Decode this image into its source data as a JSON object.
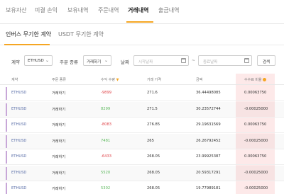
{
  "top_tabs": [
    {
      "label": "보유자산",
      "active": false
    },
    {
      "label": "미결 손익",
      "active": false
    },
    {
      "label": "보유내역",
      "active": false
    },
    {
      "label": "주문내역",
      "active": false
    },
    {
      "label": "거래내역",
      "active": true
    },
    {
      "label": "출금내역",
      "active": false
    }
  ],
  "sub_tabs": [
    {
      "label": "인버스 무기한 계약",
      "active": true
    },
    {
      "label": "USDT 무기한 계약",
      "active": false
    }
  ],
  "filters": {
    "contract_label": "계약",
    "contract_value": "ETHUSD",
    "order_type_label": "주문 종류",
    "order_type_value": "거래하기",
    "date_label": "날짜",
    "start_date_placeholder": "시작날짜",
    "end_date_placeholder": "종료날짜",
    "separator": "~",
    "search_label": "검색"
  },
  "table": {
    "headers": [
      "계약",
      "주문 종류",
      "수익 수량",
      "거래 가격",
      "금액",
      "수수료 비율"
    ],
    "rows": [
      {
        "symbol": "ETHUSD",
        "order_type": "거래하기",
        "qty": "-9899",
        "qty_sign": "neg",
        "price": "271.6",
        "amount": "36.44498085",
        "fee_rate": "0.00063750"
      },
      {
        "symbol": "ETHUSD",
        "order_type": "거래하기",
        "qty": "8299",
        "qty_sign": "pos",
        "price": "271.5",
        "amount": "30.23572744",
        "fee_rate": "-0.00025000"
      },
      {
        "symbol": "ETHUSD",
        "order_type": "거래하기",
        "qty": "-8083",
        "qty_sign": "neg",
        "price": "276.85",
        "amount": "29.19631569",
        "fee_rate": "0.00063750"
      },
      {
        "symbol": "ETHUSD",
        "order_type": "거래하기",
        "qty": "7481",
        "qty_sign": "pos",
        "price": "265",
        "amount": "26.26792452",
        "fee_rate": "-0.00025000"
      },
      {
        "symbol": "ETHUSD",
        "order_type": "거래하기",
        "qty": "-6433",
        "qty_sign": "neg",
        "price": "268.05",
        "amount": "23.99925387",
        "fee_rate": "0.00063750"
      },
      {
        "symbol": "ETHUSD",
        "order_type": "거래하기",
        "qty": "5520",
        "qty_sign": "pos",
        "price": "268.05",
        "amount": "20.59317291",
        "fee_rate": "-0.00025000"
      },
      {
        "symbol": "ETHUSD",
        "order_type": "거래하기",
        "qty": "5302",
        "qty_sign": "pos",
        "price": "268.05",
        "amount": "19.77989181",
        "fee_rate": "-0.00025000"
      }
    ]
  },
  "colors": {
    "accent": "#f5a623",
    "negative": "#e0474c",
    "positive": "#5cb85c",
    "symbol": "#5a6ea8",
    "fee_column_highlight": "#fde9e9"
  },
  "icons": {
    "sort": "sort-desc-icon",
    "fee_info": "info-icon",
    "dropdown": "chevron-down-icon",
    "date": "calendar-icon"
  }
}
